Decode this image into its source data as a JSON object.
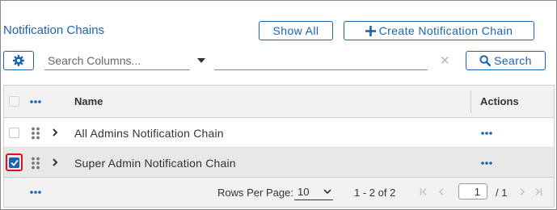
{
  "page": {
    "title": "Notification Chains"
  },
  "toolbar": {
    "show_all_label": "Show All",
    "create_label": "Create Notification Chain",
    "search_placeholder": "Search Columns...",
    "search_button_label": "Search",
    "icons": {
      "settings": "gear-icon",
      "create": "plus-icon",
      "search": "magnifier-icon",
      "column_dropdown": "caret-down-icon",
      "clear": "close-icon"
    }
  },
  "grid": {
    "columns": [
      "Name",
      "Actions"
    ],
    "rows": [
      {
        "name": "All Admins Notification Chain",
        "selected": false
      },
      {
        "name": "Super Admin Notification Chain",
        "selected": true
      }
    ]
  },
  "pagination": {
    "rows_per_page_label": "Rows Per Page:",
    "rows_per_page_value": "10",
    "range_text": "1 - 2 of 2",
    "current_page": "1",
    "total_pages_text": "/ 1"
  },
  "colors": {
    "accent": "#1b63b0",
    "selected_highlight": "#d9131f",
    "header_bg": "#f2f2f2",
    "selected_row_bg": "#e8e8e8"
  }
}
